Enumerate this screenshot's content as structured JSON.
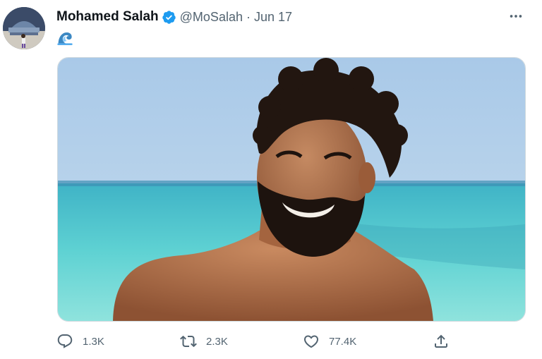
{
  "tweet": {
    "author": {
      "name": "Mohamed Salah",
      "handle": "@MoSalah",
      "verified": true
    },
    "separator": "·",
    "date": "Jun 17",
    "text_emoji": "water-wave-emoji",
    "media": {
      "type": "photo"
    },
    "actions": {
      "reply_count": "1.3K",
      "retweet_count": "2.3K",
      "like_count": "77.4K"
    }
  },
  "colors": {
    "text_primary": "#0f1419",
    "text_secondary": "#536471",
    "verified_blue": "#1d9bf0",
    "border": "#cfd9de"
  },
  "icons": [
    "avatar",
    "verified-badge-icon",
    "more-icon",
    "reply-icon",
    "retweet-icon",
    "like-icon",
    "share-icon"
  ]
}
